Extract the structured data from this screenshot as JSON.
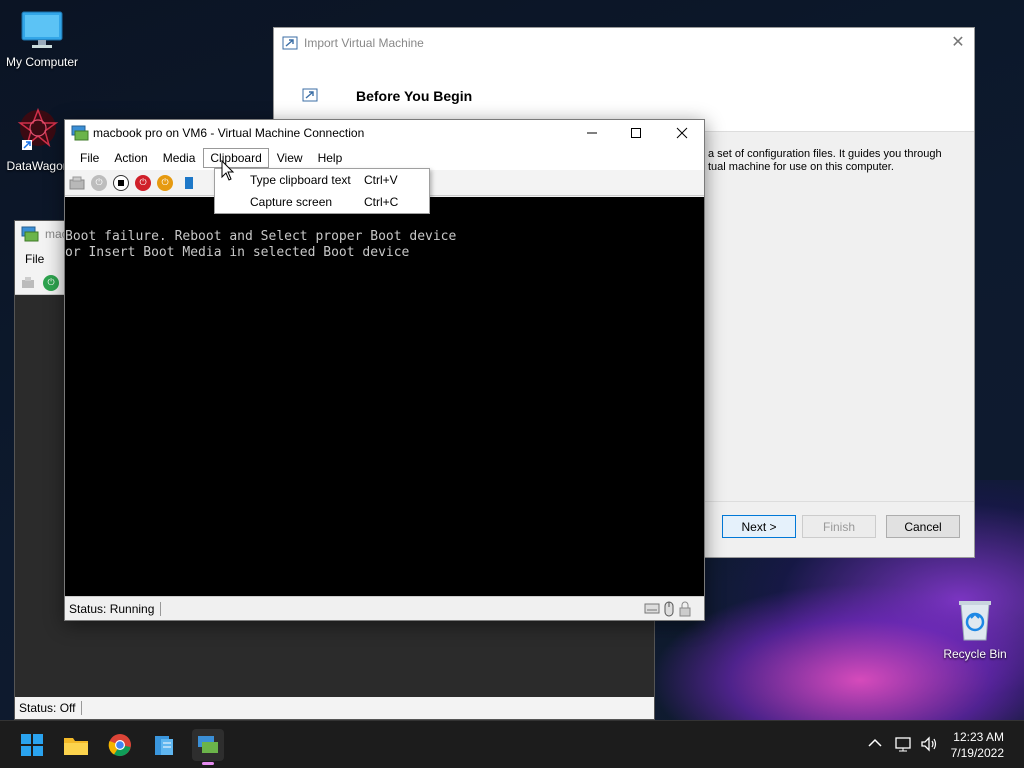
{
  "desktop": {
    "icons": [
      {
        "label": "My Computer"
      },
      {
        "label": "DataWagon"
      },
      {
        "label": "Recycle Bin"
      }
    ]
  },
  "back_window": {
    "title": "mac",
    "menu_file": "File",
    "status": "Status: Off"
  },
  "wizard": {
    "title": "Import Virtual Machine",
    "heading": "Before You Begin",
    "description": "a set of configuration files. It guides you through\ntual machine for use on this computer.",
    "buttons": {
      "next": "Next >",
      "finish": "Finish",
      "cancel": "Cancel"
    }
  },
  "vm_window": {
    "title": "macbook pro on VM6 - Virtual Machine Connection",
    "menu": [
      "File",
      "Action",
      "Media",
      "Clipboard",
      "View",
      "Help"
    ],
    "active_menu": "Clipboard",
    "screen_lines": [
      "Boot failure. Reboot and Select proper Boot device",
      "or Insert Boot Media in selected Boot device"
    ],
    "status": "Status: Running"
  },
  "clipboard_menu": {
    "items": [
      {
        "label": "Type clipboard text",
        "shortcut": "Ctrl+V"
      },
      {
        "label": "Capture screen",
        "shortcut": "Ctrl+C"
      }
    ]
  },
  "taskbar": {
    "time": "12:23 AM",
    "date": "7/19/2022"
  },
  "colors": {
    "accent": "#0078d7",
    "screen_bg": "#000000",
    "screen_text": "#c8c8c8",
    "taskbar_bg": "#1c1c1c"
  }
}
